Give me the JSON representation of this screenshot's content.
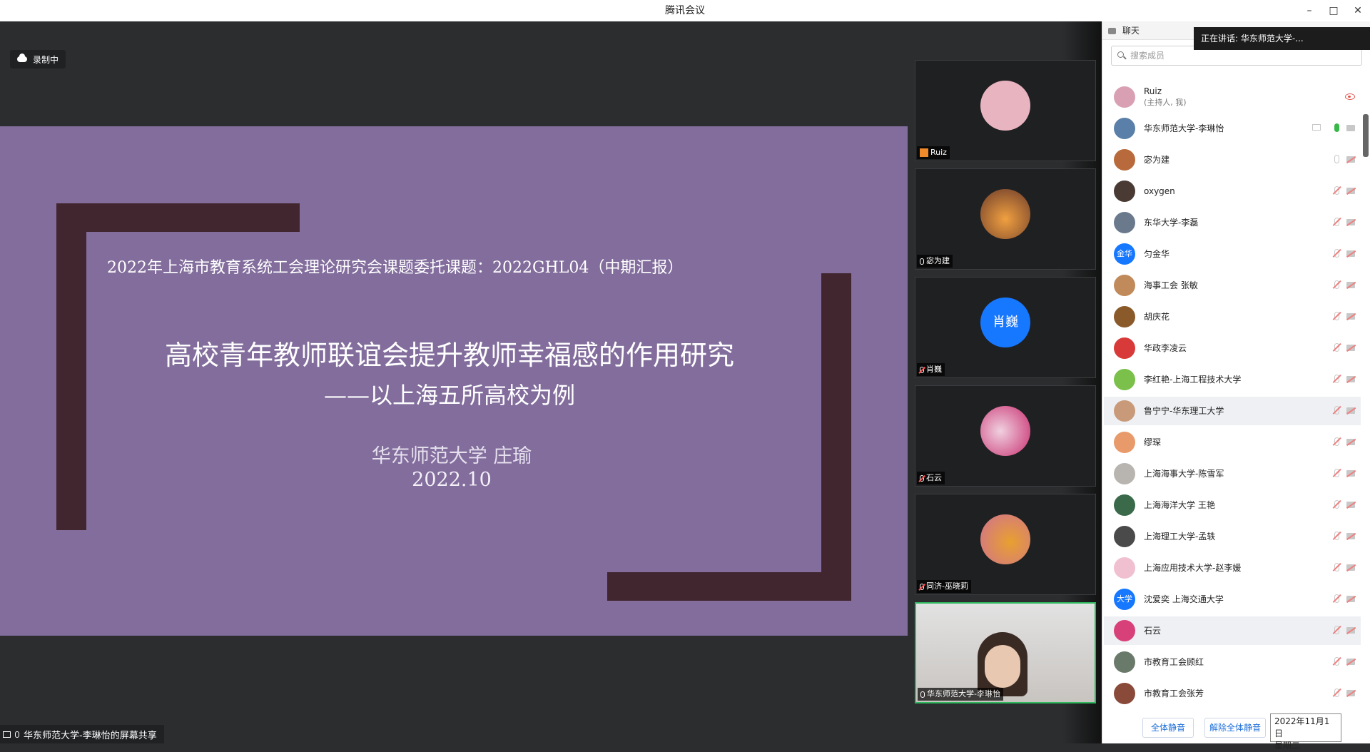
{
  "window": {
    "title": "腾讯会议",
    "minimize": "–",
    "maximize": "□",
    "close": "✕"
  },
  "recording": {
    "label": "录制中"
  },
  "slide": {
    "line1": "2022年上海市教育系统工会理论研究会课题委托课题：2022GHL04（中期汇报）",
    "title": "高校青年教师联谊会提升教师幸福感的作用研究",
    "subtitle": "——以上海五所高校为例",
    "author": "华东师范大学 庄瑜",
    "date": "2022.10"
  },
  "share": {
    "label": "华东师范大学-李琳怡的屏幕共享"
  },
  "video_tiles": [
    {
      "name": "Ruiz",
      "avatar_color": "#e8b4c0"
    },
    {
      "name": "宓为建",
      "avatar_color": "#c8744a"
    },
    {
      "name": "肖巍",
      "avatar_text": "肖巍",
      "avatar_color": "#1677ff"
    },
    {
      "name": "石云",
      "avatar_color": "#d8407a"
    },
    {
      "name": "同济-巫晓莉",
      "avatar_color": "#d89a3a"
    },
    {
      "name": "华东师范大学-李琳怡",
      "avatar_color": "#c9c2bb"
    }
  ],
  "panel": {
    "header": "聊天",
    "speaking": "正在讲话: 华东师范大学-...",
    "search_placeholder": "搜索成员",
    "members": [
      {
        "name": "Ruiz",
        "sub": "(主持人, 我)",
        "color": "#d9a0b4"
      },
      {
        "name": "华东师范大学-李琳怡",
        "color": "#5a7fa8"
      },
      {
        "name": "宓为建",
        "color": "#b86a3c"
      },
      {
        "name": "oxygen",
        "color": "#4a3a34"
      },
      {
        "name": "东华大学-李磊",
        "color": "#6a7a8c"
      },
      {
        "name": "匀金华",
        "avatar_text": "金华",
        "color": "#1677ff"
      },
      {
        "name": "海事工会 张敏",
        "color": "#c08a5a"
      },
      {
        "name": "胡庆花",
        "color": "#8a5a2a"
      },
      {
        "name": "华政李凌云",
        "color": "#d83a3a"
      },
      {
        "name": "李红艳-上海工程技术大学",
        "color": "#7ac04a"
      },
      {
        "name": "鲁宁宁-华东理工大学",
        "color": "#c89a7a"
      },
      {
        "name": "缪琛",
        "color": "#e89a6a"
      },
      {
        "name": "上海海事大学-陈雪军",
        "color": "#b8b4b0"
      },
      {
        "name": "上海海洋大学 王艳",
        "color": "#3a6a4a"
      },
      {
        "name": "上海理工大学-孟轶",
        "color": "#4a4a4a"
      },
      {
        "name": "上海应用技术大学-赵李媛",
        "color": "#f0c0d0"
      },
      {
        "name": "沈爱奕 上海交通大学",
        "avatar_text": "大学",
        "color": "#1677ff"
      },
      {
        "name": "石云",
        "color": "#d8407a"
      },
      {
        "name": "市教育工会顾红",
        "color": "#6a7a6a"
      },
      {
        "name": "市教育工会张芳",
        "color": "#8a4a3a"
      }
    ],
    "mute_all": "全体静音",
    "unmute_all": "解除全体静音",
    "tooltip_date": "2022年11月1日",
    "tooltip_weekday": "星期二"
  }
}
